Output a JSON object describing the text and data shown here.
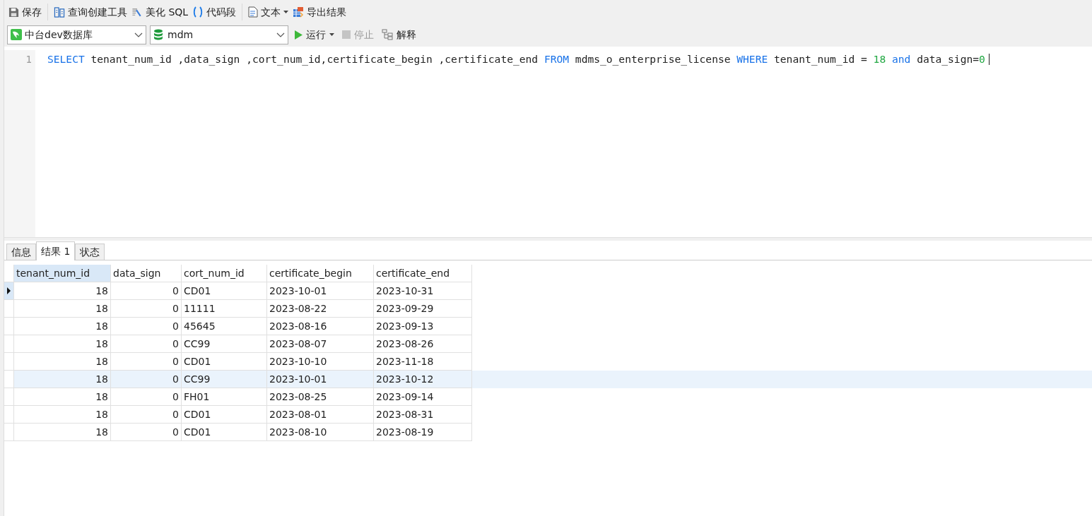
{
  "toolbar": {
    "buttons": [
      {
        "label": "保存",
        "dropdown": false
      },
      {
        "label": "查询创建工具",
        "dropdown": false
      },
      {
        "label": "美化 SQL",
        "dropdown": false
      },
      {
        "label": "代码段",
        "dropdown": false
      },
      {
        "label": "文本",
        "dropdown": true
      },
      {
        "label": "导出结果",
        "dropdown": false
      }
    ]
  },
  "connection": {
    "value": "中台dev数据库"
  },
  "database": {
    "value": "mdm"
  },
  "actions": [
    {
      "label": "运行",
      "dropdown": true,
      "disabled": false
    },
    {
      "label": "停止",
      "dropdown": false,
      "disabled": true
    },
    {
      "label": "解释",
      "dropdown": false,
      "disabled": false
    }
  ],
  "editor": {
    "lines": [
      {
        "number": "1",
        "tokens": [
          {
            "kind": "keyword",
            "text": "SELECT"
          },
          {
            "kind": "ident",
            "text": " tenant_num_id ,data_sign ,cort_num_id,certificate_begin ,certificate_end "
          },
          {
            "kind": "keyword",
            "text": "FROM"
          },
          {
            "kind": "ident",
            "text": " mdms_o_enterprise_license "
          },
          {
            "kind": "keyword",
            "text": "WHERE"
          },
          {
            "kind": "ident",
            "text": " tenant_num_id = "
          },
          {
            "kind": "number",
            "text": "18"
          },
          {
            "kind": "keyword",
            "text": " and"
          },
          {
            "kind": "ident",
            "text": " data_sign="
          },
          {
            "kind": "number",
            "text": "0"
          }
        ]
      }
    ]
  },
  "result_tabs": [
    {
      "label": "信息",
      "selected": false
    },
    {
      "label": "结果 1",
      "selected": true
    },
    {
      "label": "状态",
      "selected": false
    }
  ],
  "table": {
    "columns": [
      {
        "label": "tenant_num_id",
        "selected": true
      },
      {
        "label": "data_sign",
        "selected": false
      },
      {
        "label": "cort_num_id",
        "selected": false
      },
      {
        "label": "certificate_begin",
        "selected": false
      },
      {
        "label": "certificate_end",
        "selected": false
      }
    ],
    "rows": [
      {
        "current": true,
        "highlighted": false,
        "cells": [
          "18",
          "0",
          "CD01",
          "2023-10-01",
          "2023-10-31"
        ]
      },
      {
        "current": false,
        "highlighted": false,
        "cells": [
          "18",
          "0",
          "11111",
          "2023-08-22",
          "2023-09-29"
        ]
      },
      {
        "current": false,
        "highlighted": false,
        "cells": [
          "18",
          "0",
          "45645",
          "2023-08-16",
          "2023-09-13"
        ]
      },
      {
        "current": false,
        "highlighted": false,
        "cells": [
          "18",
          "0",
          "CC99",
          "2023-08-07",
          "2023-08-26"
        ]
      },
      {
        "current": false,
        "highlighted": false,
        "cells": [
          "18",
          "0",
          "CD01",
          "2023-10-10",
          "2023-11-18"
        ]
      },
      {
        "current": false,
        "highlighted": true,
        "cells": [
          "18",
          "0",
          "CC99",
          "2023-10-01",
          "2023-10-12"
        ]
      },
      {
        "current": false,
        "highlighted": false,
        "cells": [
          "18",
          "0",
          "FH01",
          "2023-08-25",
          "2023-09-14"
        ]
      },
      {
        "current": false,
        "highlighted": false,
        "cells": [
          "18",
          "0",
          "CD01",
          "2023-08-01",
          "2023-08-31"
        ]
      },
      {
        "current": false,
        "highlighted": false,
        "cells": [
          "18",
          "0",
          "CD01",
          "2023-08-10",
          "2023-08-19"
        ]
      }
    ]
  }
}
